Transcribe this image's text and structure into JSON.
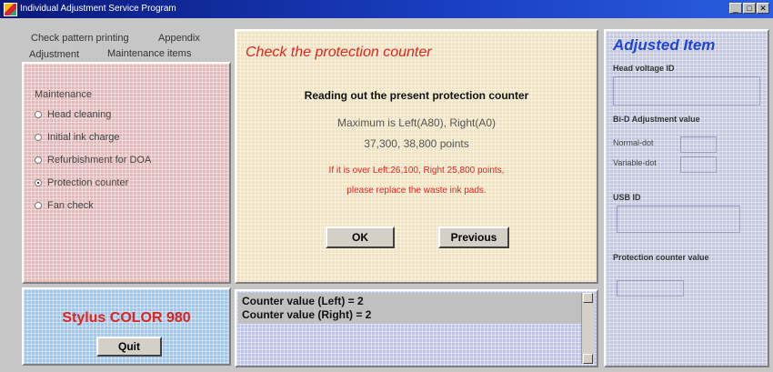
{
  "window": {
    "title": "Individual Adjustment Service Program",
    "icon": "printer-app-icon"
  },
  "tabs": {
    "row1": [
      "Check pattern printing",
      "Appendix"
    ],
    "row2": [
      "Adjustment",
      "Maintenance items"
    ]
  },
  "maintenance": {
    "label": "Maintenance",
    "options": [
      {
        "label": "Head cleaning",
        "selected": false
      },
      {
        "label": "Initial ink charge",
        "selected": false
      },
      {
        "label": "Refurbishment for DOA",
        "selected": false
      },
      {
        "label": "Protection counter",
        "selected": true
      },
      {
        "label": "Fan check",
        "selected": false
      }
    ]
  },
  "model": {
    "name": "Stylus COLOR 980",
    "color": "#e0241c"
  },
  "quit_label": "Quit",
  "center": {
    "title": "Check the protection counter",
    "heading": "Reading out the present protection counter",
    "max_line": "Maximum is Left(A80), Right(A0)",
    "points_line": "37,300,  38,800 points",
    "warn_line1": "If it is over Left:26,100, Right 25,800 points,",
    "warn_line2": "please replace the waste ink pads.",
    "ok_label": "OK",
    "previous_label": "Previous"
  },
  "log": {
    "lines": [
      "Counter value (Left) = 2",
      "Counter value (Right) = 2"
    ]
  },
  "right": {
    "title": "Adjusted Item",
    "head_voltage_label": "Head voltage ID",
    "bi_d_label": "Bi-D Adjustment value",
    "normal_dot": "Normal-dot",
    "variable_dot": "Variable-dot",
    "usb_label": "USB ID",
    "protection_label": "Protection counter value"
  },
  "colors": {
    "accent_red": "#e0241c",
    "accent_blue": "#2046d6"
  }
}
